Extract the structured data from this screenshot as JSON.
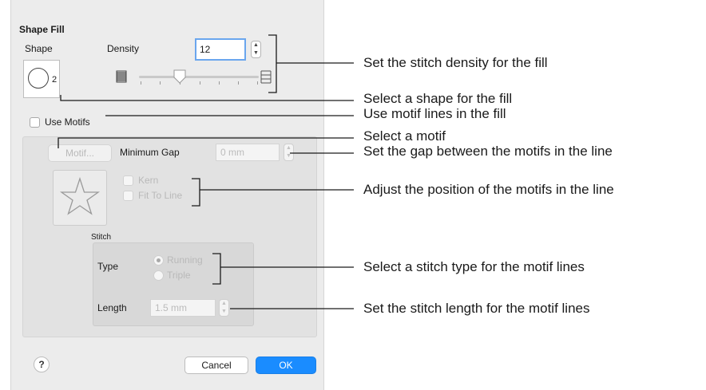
{
  "dialog": {
    "title": "Shape Fill",
    "shape_label": "Shape",
    "shape_value": "2",
    "shape_icon": "circle-icon",
    "density_label": "Density",
    "density_value": "12",
    "density_slider_fraction": 0.3,
    "use_motifs_label": "Use Motifs",
    "use_motifs_checked": false,
    "motif_button_label": "Motif...",
    "minimum_gap_label": "Minimum Gap",
    "minimum_gap_value": "0 mm",
    "motif_preview_icon": "star-icon",
    "kern_label": "Kern",
    "fit_to_line_label": "Fit To Line",
    "stitch_section_label": "Stitch",
    "type_label": "Type",
    "type_options": [
      "Running",
      "Triple"
    ],
    "type_selected": "Running",
    "length_label": "Length",
    "length_value": "1.5 mm",
    "help_label": "?",
    "cancel_label": "Cancel",
    "ok_label": "OK"
  },
  "annotations": [
    "Set the stitch density for the fill",
    "Select a shape for the fill",
    "Use motif lines in the fill",
    "Select a motif",
    "Set the gap between the motifs in the line",
    "Adjust the position of the motifs in the line",
    "Select a stitch type for the motif lines",
    "Set the stitch length for the motif lines"
  ],
  "colors": {
    "ok_button": "#1a8cff",
    "focus_ring": "#6aa6ee",
    "dialog_bg": "#ececec"
  }
}
